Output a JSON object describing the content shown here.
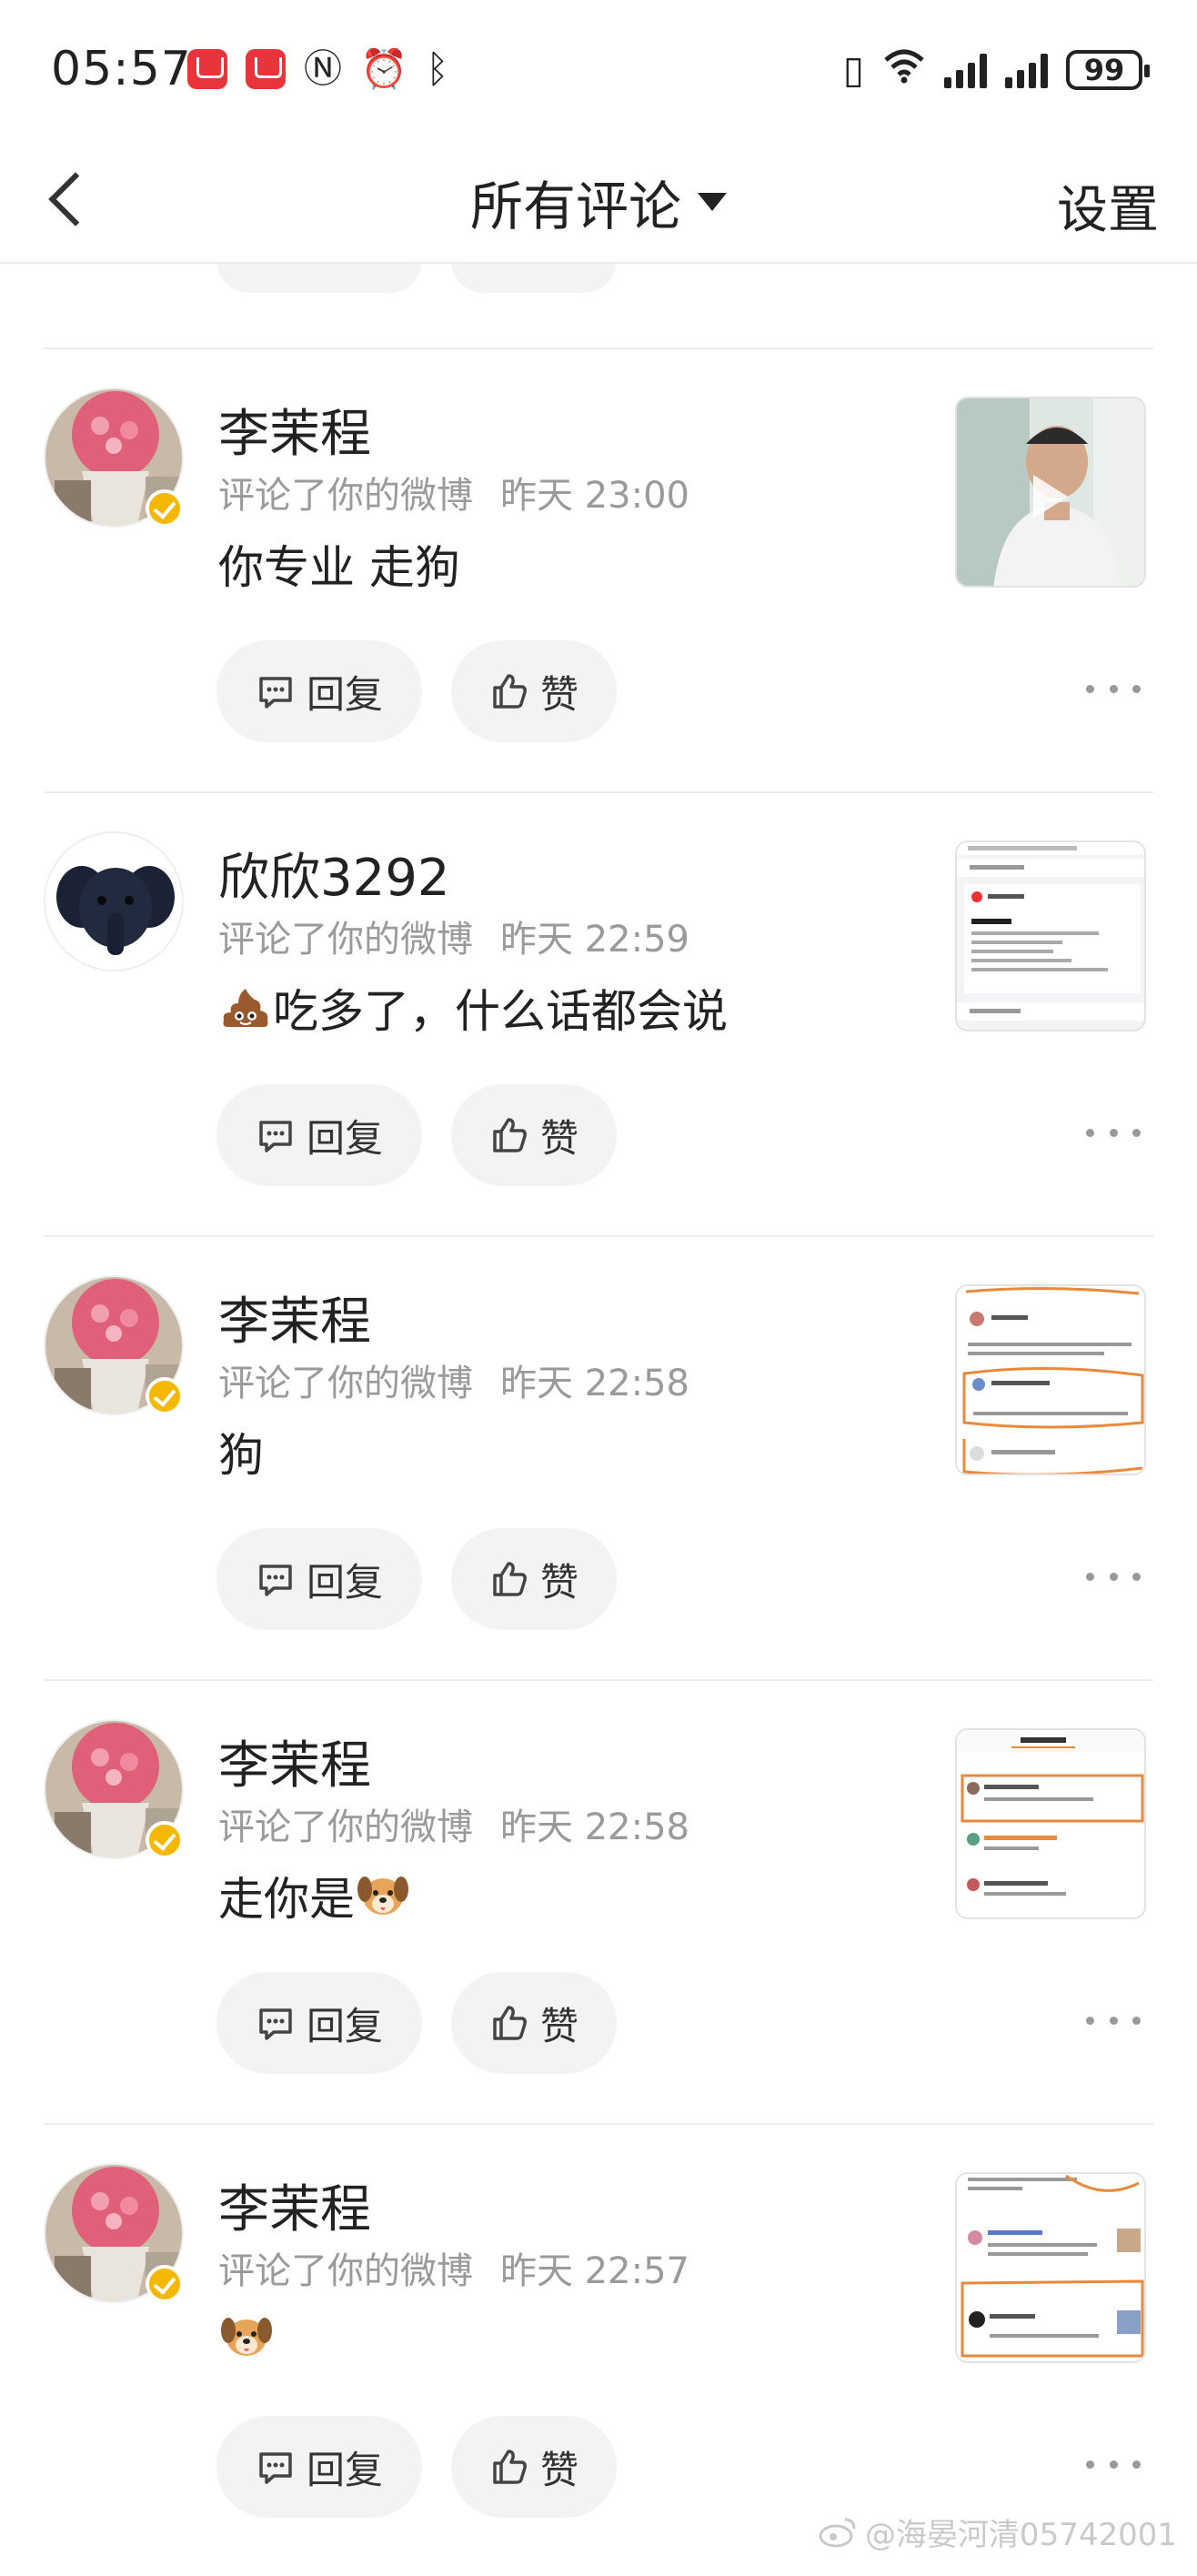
{
  "status_bar": {
    "time": "05:57",
    "battery": "99",
    "network": "6"
  },
  "nav": {
    "title": "所有评论",
    "settings": "设置"
  },
  "comments": [
    {
      "name": "李茉程",
      "action": "评论了你的微博",
      "time": "昨天 23:00",
      "content": "你专业 走狗",
      "verified": true,
      "reply_label": "回复",
      "like_label": "赞",
      "thumb": "video"
    },
    {
      "name": "欣欣3292",
      "action": "评论了你的微博",
      "time": "昨天 22:59",
      "content": "吃多了，什么话都会说",
      "content_emoji": "poop",
      "verified": false,
      "reply_label": "回复",
      "like_label": "赞",
      "thumb": "document"
    },
    {
      "name": "李茉程",
      "action": "评论了你的微博",
      "time": "昨天 22:58",
      "content": "狗",
      "verified": true,
      "reply_label": "回复",
      "like_label": "赞",
      "thumb": "screenshot"
    },
    {
      "name": "李茉程",
      "action": "评论了你的微博",
      "time": "昨天 22:58",
      "content": "走你是",
      "content_emoji": "dog-face",
      "verified": true,
      "reply_label": "回复",
      "like_label": "赞",
      "thumb": "screenshot"
    },
    {
      "name": "李茉程",
      "action": "评论了你的微博",
      "time": "昨天 22:57",
      "content": "",
      "content_emoji": "dog-face",
      "verified": true,
      "reply_label": "回复",
      "like_label": "赞",
      "thumb": "screenshot"
    }
  ],
  "watermark": "@海晏河清05742001",
  "colors": {
    "verified": "#f5b800",
    "meta_text": "#9a9a9a",
    "button_bg": "#f3f3f3"
  }
}
